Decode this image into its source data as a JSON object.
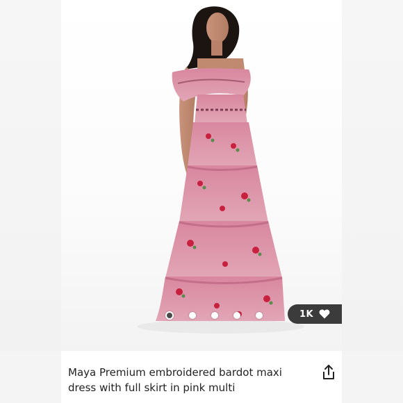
{
  "listing": {
    "title_line1": "Maya Premium embroidered bardot maxi",
    "title_line2": "dress with full skirt in pink multi",
    "likes_count": "1K",
    "image_alt": "Model wearing pink embroidered bardot tiered maxi dress"
  },
  "carousel": {
    "total_images": 5,
    "active_index": 0
  },
  "icons": {
    "like": "heart-icon",
    "share": "share-icon"
  },
  "colors": {
    "dress_pink": "#d98fa3",
    "pill_bg": "#3b3b3b",
    "text": "#222222"
  }
}
